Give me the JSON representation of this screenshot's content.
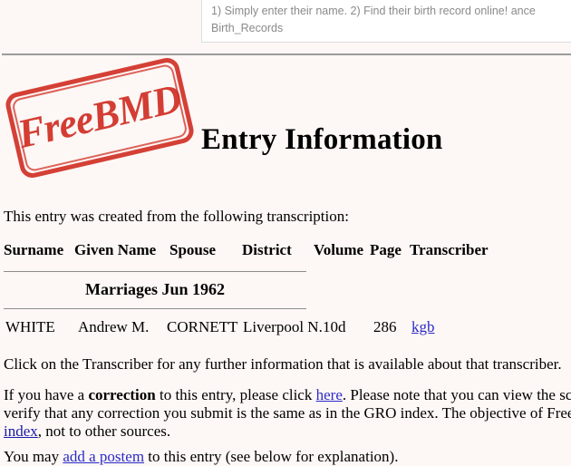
{
  "ad": {
    "text_line1": "1) Simply enter their name. 2) Find their birth record online! ance",
    "text_line2": "Birth_Records"
  },
  "logo": {
    "text": "FreeBMD",
    "color": "#d03025"
  },
  "header": {
    "title": "Entry Information"
  },
  "intro": {
    "text": "This entry was created from the following transcription:"
  },
  "table": {
    "headers": {
      "surname": "Surname",
      "given_name": "Given Name",
      "spouse": "Spouse",
      "district": "District",
      "volume": "Volume",
      "page": "Page",
      "transcriber": "Transcriber"
    },
    "period": "Marriages Jun 1962",
    "row": {
      "surname": "WHITE",
      "given_name": "Andrew M.",
      "spouse": "CORNETT",
      "district": "Liverpool N.",
      "volume": "10d",
      "page": "286",
      "transcriber": "kgb"
    }
  },
  "notes": {
    "transcriber_note": "Click on the Transcriber for any further information that is available about that transcriber.",
    "correction": {
      "l1_a": "If you have a ",
      "l1_b": "correction",
      "l1_c": " to this entry, please click ",
      "l1_link": "here",
      "l1_d": ". Please note that you can view the scan fro",
      "l2_a": "verify that any correction you submit is the same as in the GRO index. The objective of FreeBMD",
      "l3_link": "index",
      "l3_a": ", not to other sources."
    },
    "postem": {
      "a": "You may ",
      "link": "add a postem",
      "b": " to this entry (see below for explanation)."
    }
  },
  "colors": {
    "background": "#fdf7f5",
    "link": "#2b2bc8",
    "stamp_red": "#d03025",
    "rule": "#9b9b9b"
  }
}
